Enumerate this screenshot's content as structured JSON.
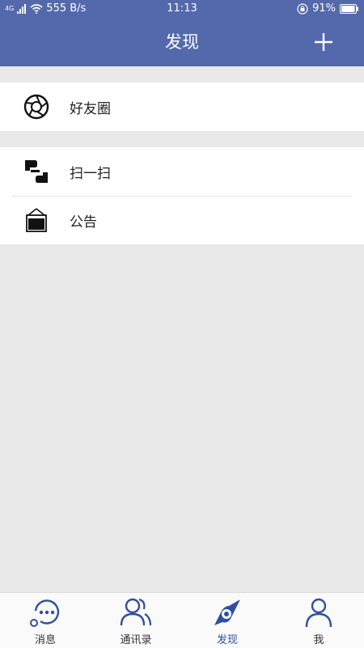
{
  "status_bar": {
    "network": "4G",
    "speed": "555 B/s",
    "time": "11:13",
    "battery": "91%"
  },
  "header": {
    "title": "发现",
    "add_icon": "plus-icon"
  },
  "sections": [
    {
      "items": [
        {
          "label": "好友圈",
          "icon": "aperture-icon"
        }
      ]
    },
    {
      "items": [
        {
          "label": "扫一扫",
          "icon": "scan-icon"
        },
        {
          "label": "公告",
          "icon": "announcement-icon"
        }
      ]
    }
  ],
  "tabs": [
    {
      "label": "消息",
      "icon": "message-icon"
    },
    {
      "label": "通讯录",
      "icon": "contacts-icon"
    },
    {
      "label": "发现",
      "icon": "compass-icon",
      "active": true
    },
    {
      "label": "我",
      "icon": "profile-icon"
    }
  ],
  "colors": {
    "primary": "#5369ab",
    "active_tab": "#2f4f9f",
    "background": "#e9e9e9"
  }
}
